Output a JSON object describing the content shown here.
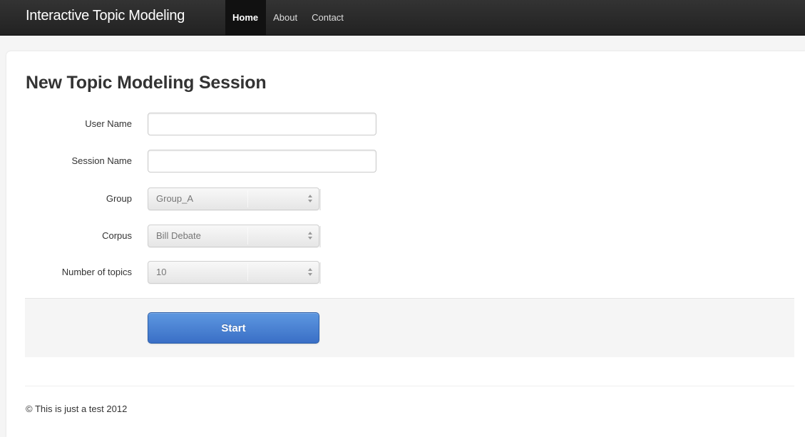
{
  "navbar": {
    "brand": "Interactive Topic Modeling",
    "items": [
      {
        "label": "Home",
        "active": true
      },
      {
        "label": "About",
        "active": false
      },
      {
        "label": "Contact",
        "active": false
      }
    ]
  },
  "page": {
    "title": "New Topic Modeling Session"
  },
  "form": {
    "user_name": {
      "label": "User Name",
      "value": "",
      "placeholder": ""
    },
    "session_name": {
      "label": "Session Name",
      "value": "",
      "placeholder": ""
    },
    "group": {
      "label": "Group",
      "selected": "Group_A"
    },
    "corpus": {
      "label": "Corpus",
      "selected": "Bill Debate"
    },
    "num_topics": {
      "label": "Number of topics",
      "selected": "10"
    },
    "submit_label": "Start"
  },
  "footer": {
    "text": "© This is just a test 2012"
  },
  "colors": {
    "navbar": "#222222",
    "primary_button": "#4a82d6",
    "background": "#f5f5f5"
  }
}
